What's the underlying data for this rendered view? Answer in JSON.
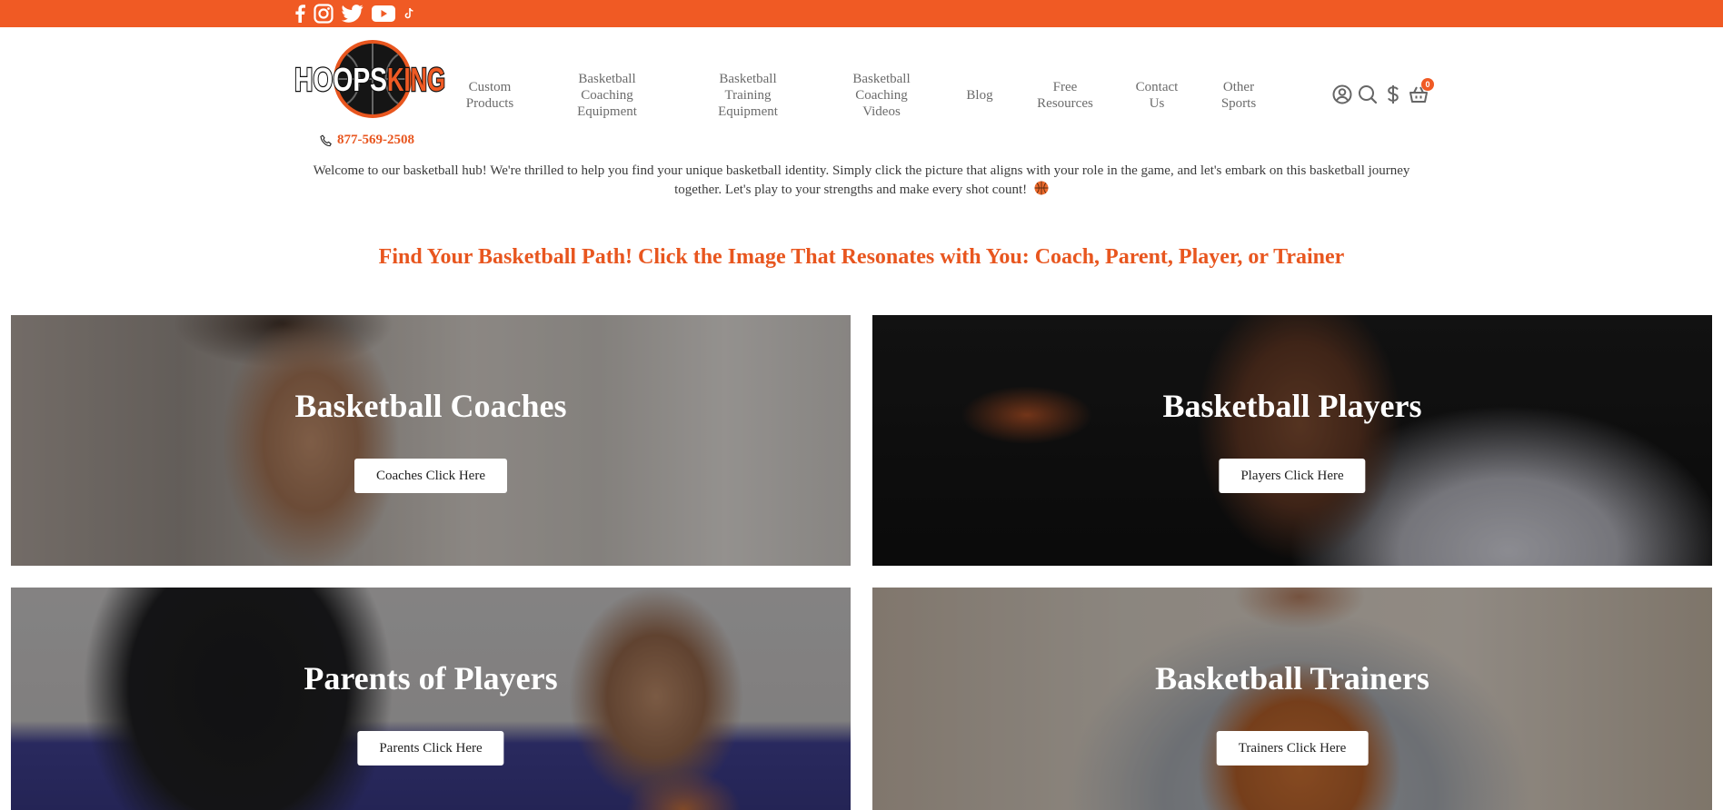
{
  "topbar": {
    "color": "#f05a24",
    "social": [
      {
        "name": "facebook",
        "icon": "facebook-icon"
      },
      {
        "name": "instagram",
        "icon": "instagram-icon"
      },
      {
        "name": "twitter",
        "icon": "twitter-icon"
      },
      {
        "name": "youtube",
        "icon": "youtube-icon"
      },
      {
        "name": "tiktok",
        "icon": "tiktok-icon"
      }
    ]
  },
  "header": {
    "logo": {
      "part1": "HOOPS",
      "part2": "KING"
    },
    "phone": "877-569-2508",
    "nav": [
      {
        "label": "Custom\nProducts"
      },
      {
        "label": "Basketball\nCoaching\nEquipment"
      },
      {
        "label": "Basketball\nTraining\nEquipment"
      },
      {
        "label": "Basketball\nCoaching\nVideos"
      },
      {
        "label": "Blog"
      },
      {
        "label": "Free\nResources"
      },
      {
        "label": "Contact\nUs"
      },
      {
        "label": "Other\nSports"
      }
    ],
    "icons": [
      "account-icon",
      "search-icon",
      "currency-icon",
      "cart-icon"
    ],
    "cart_count": "0"
  },
  "intro": {
    "text": "Welcome to our basketball hub! We're thrilled to help you find your unique basketball identity. Simply click the picture that aligns with your role in the game, and let's embark on this basketball journey together. Let's play to your strengths and make every shot count!"
  },
  "headline": "Find Your Basketball Path! Click the Image That Resonates with You: Coach, Parent, Player, or Trainer",
  "cards": {
    "coaches": {
      "title": "Basketball Coaches",
      "button": "Coaches Click Here"
    },
    "players": {
      "title": "Basketball Players",
      "button": "Players Click Here"
    },
    "parents": {
      "title": "Parents of Players",
      "button": "Parents Click Here"
    },
    "trainers": {
      "title": "Basketball Trainers",
      "button": "Trainers Click Here"
    }
  },
  "colors": {
    "accent": "#f05a24",
    "headline": "#e8561f",
    "nav_text": "#6b6b6b"
  }
}
